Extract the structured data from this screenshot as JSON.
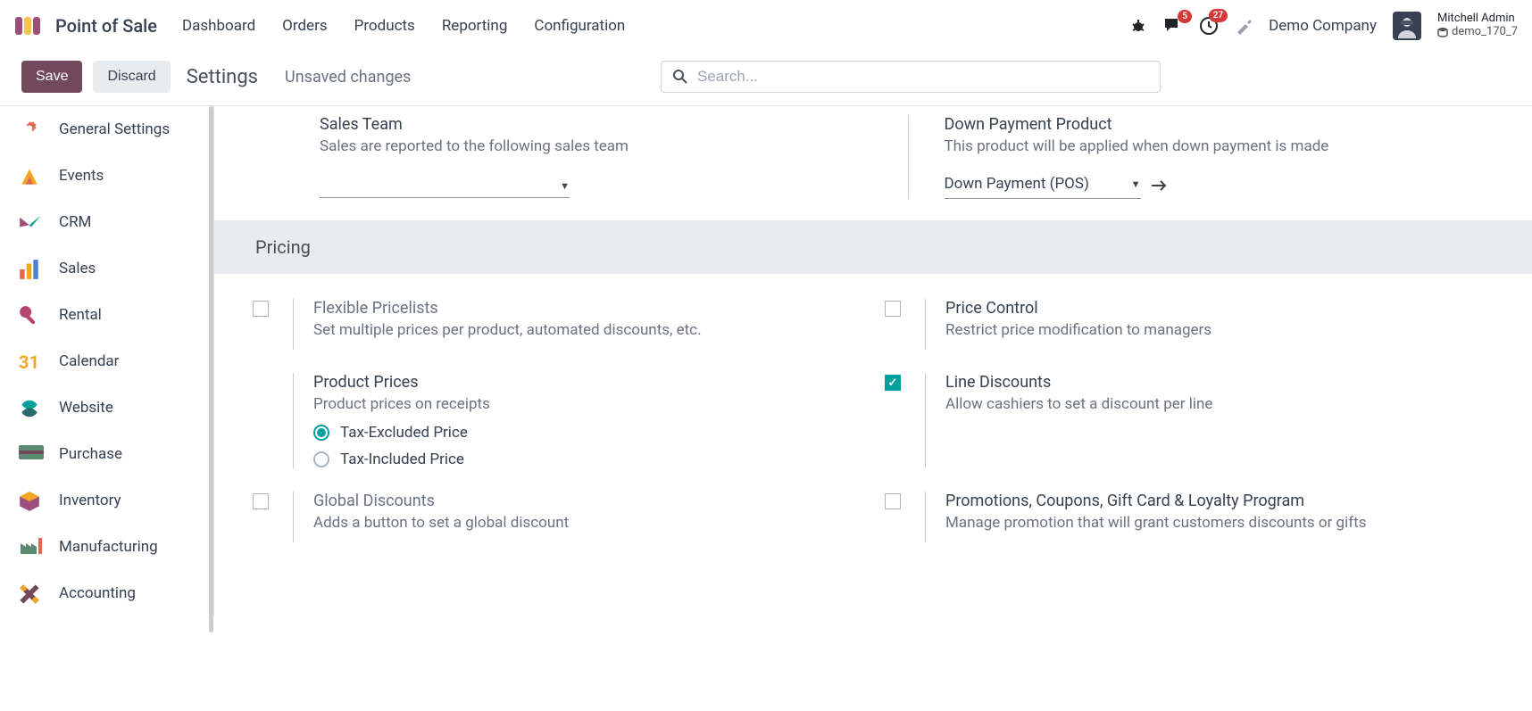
{
  "header": {
    "app_title": "Point of Sale",
    "menu": [
      "Dashboard",
      "Orders",
      "Products",
      "Reporting",
      "Configuration"
    ],
    "badges": {
      "messages": "5",
      "activities": "27"
    },
    "company": "Demo Company",
    "user_name": "Mitchell Admin",
    "db_name": "demo_170_7"
  },
  "controlbar": {
    "save": "Save",
    "discard": "Discard",
    "breadcrumb": "Settings",
    "unsaved": "Unsaved changes",
    "search_placeholder": "Search..."
  },
  "sidebar": [
    {
      "label": "General Settings"
    },
    {
      "label": "Events"
    },
    {
      "label": "CRM"
    },
    {
      "label": "Sales"
    },
    {
      "label": "Rental"
    },
    {
      "label": "Calendar"
    },
    {
      "label": "Website"
    },
    {
      "label": "Purchase"
    },
    {
      "label": "Inventory"
    },
    {
      "label": "Manufacturing"
    },
    {
      "label": "Accounting"
    }
  ],
  "top_settings": {
    "sales_team": {
      "title": "Sales Team",
      "desc": "Sales are reported to the following sales team",
      "value": ""
    },
    "down_payment": {
      "title": "Down Payment Product",
      "desc": "This product will be applied when down payment is made",
      "value": "Down Payment (POS)"
    }
  },
  "section_pricing": "Pricing",
  "pricing": {
    "flexible": {
      "title": "Flexible Pricelists",
      "desc": "Set multiple prices per product, automated discounts, etc.",
      "checked": false
    },
    "price_control": {
      "title": "Price Control",
      "desc": "Restrict price modification to managers",
      "checked": false
    },
    "product_prices": {
      "title": "Product Prices",
      "desc": "Product prices on receipts",
      "radio_excluded": "Tax-Excluded Price",
      "radio_included": "Tax-Included Price",
      "selected": "excluded"
    },
    "line_discounts": {
      "title": "Line Discounts",
      "desc": "Allow cashiers to set a discount per line",
      "checked": true
    },
    "global_discounts": {
      "title": "Global Discounts",
      "desc": "Adds a button to set a global discount",
      "checked": false
    },
    "promotions": {
      "title": "Promotions, Coupons, Gift Card & Loyalty Program",
      "desc": "Manage promotion that will grant customers discounts or gifts",
      "checked": false
    }
  }
}
